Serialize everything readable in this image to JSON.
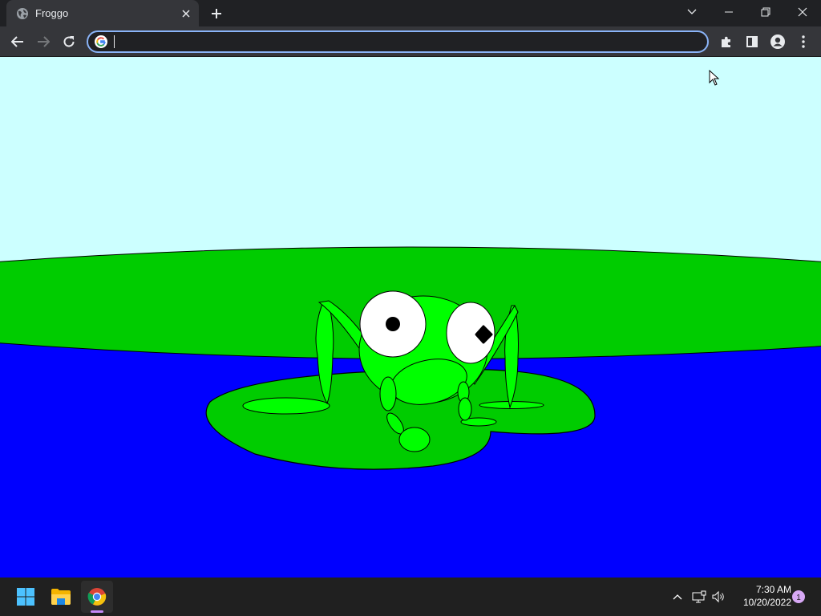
{
  "browser": {
    "tab": {
      "title": "Froggo",
      "favicon": "globe-icon"
    },
    "omnibox": {
      "value": "",
      "placeholder": ""
    },
    "toolbar_icons": [
      "back-icon",
      "forward-icon",
      "reload-icon",
      "extensions-icon",
      "side-panel-icon",
      "profile-icon",
      "more-icon"
    ]
  },
  "page": {
    "scene": "frog-on-lily-pad",
    "colors": {
      "sky": "#ccffff",
      "grass": "#00cc00",
      "water": "#0000ff",
      "lily_pad": "#00cc00",
      "frog": "#00ff00",
      "eye": "#ffffff",
      "pupil": "#000000"
    }
  },
  "taskbar": {
    "pinned": [
      "windows-start-icon",
      "file-explorer-icon",
      "chrome-icon"
    ],
    "clock": {
      "time": "7:30 AM",
      "date": "10/20/2022"
    },
    "notification_count": "1"
  }
}
